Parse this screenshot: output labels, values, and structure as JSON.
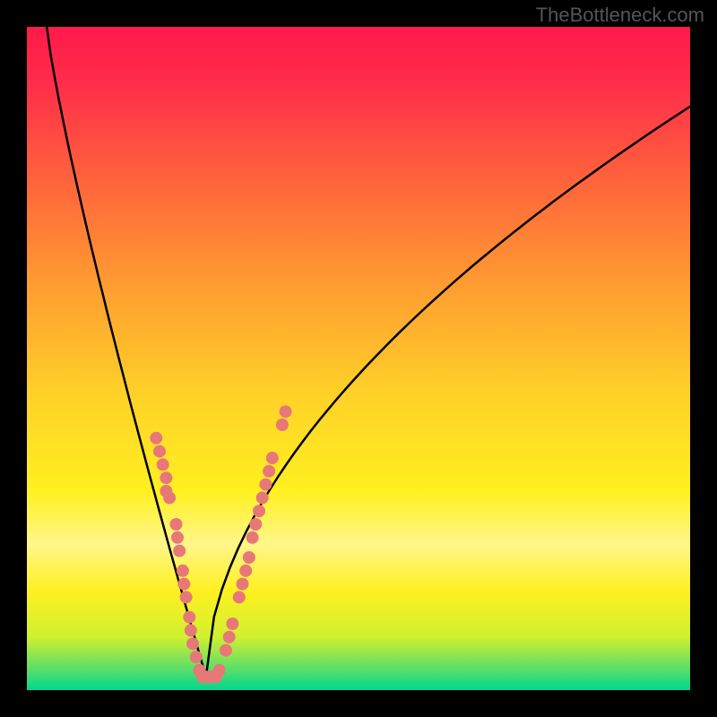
{
  "watermark": "TheBottleneck.com",
  "chart_data": {
    "type": "line",
    "title": "",
    "xlabel": "",
    "ylabel": "",
    "xlim": [
      0,
      100
    ],
    "ylim": [
      0,
      100
    ],
    "background_gradient": {
      "stops": [
        {
          "pos": 0,
          "color": "#ff1a4a"
        },
        {
          "pos": 0.08,
          "color": "#ff2b4a"
        },
        {
          "pos": 0.25,
          "color": "#ff6a3a"
        },
        {
          "pos": 0.4,
          "color": "#ffa030"
        },
        {
          "pos": 0.55,
          "color": "#ffd028"
        },
        {
          "pos": 0.7,
          "color": "#fff020"
        },
        {
          "pos": 0.78,
          "color": "#fff68a"
        },
        {
          "pos": 0.85,
          "color": "#fff020"
        },
        {
          "pos": 0.92,
          "color": "#d0f030"
        },
        {
          "pos": 0.96,
          "color": "#70e060"
        },
        {
          "pos": 1.0,
          "color": "#00d890"
        }
      ]
    },
    "curve": {
      "type": "v_shape",
      "minimum_x": 27,
      "minimum_y": 98,
      "left_branch_start": {
        "x": 3,
        "y": 0
      },
      "right_branch_end": {
        "x": 100,
        "y": 12
      },
      "description": "V-shaped valley curve with steep descent and shallower ascent"
    },
    "scatter_points": {
      "color": "#e87878",
      "radius": 7,
      "points": [
        {
          "x": 19.5,
          "y": 62
        },
        {
          "x": 20.0,
          "y": 64
        },
        {
          "x": 20.5,
          "y": 66
        },
        {
          "x": 21.0,
          "y": 68
        },
        {
          "x": 21.0,
          "y": 70
        },
        {
          "x": 21.5,
          "y": 71
        },
        {
          "x": 22.5,
          "y": 75
        },
        {
          "x": 22.7,
          "y": 77
        },
        {
          "x": 23.0,
          "y": 79
        },
        {
          "x": 23.5,
          "y": 82
        },
        {
          "x": 23.7,
          "y": 84
        },
        {
          "x": 24.0,
          "y": 86
        },
        {
          "x": 24.5,
          "y": 89
        },
        {
          "x": 24.7,
          "y": 91
        },
        {
          "x": 25.0,
          "y": 93
        },
        {
          "x": 25.5,
          "y": 95
        },
        {
          "x": 26.0,
          "y": 97
        },
        {
          "x": 26.5,
          "y": 98
        },
        {
          "x": 27.0,
          "y": 98
        },
        {
          "x": 27.5,
          "y": 98
        },
        {
          "x": 28.0,
          "y": 98
        },
        {
          "x": 28.5,
          "y": 98
        },
        {
          "x": 29.0,
          "y": 97
        },
        {
          "x": 30.0,
          "y": 94
        },
        {
          "x": 30.5,
          "y": 92
        },
        {
          "x": 31.0,
          "y": 90
        },
        {
          "x": 32.0,
          "y": 86
        },
        {
          "x": 32.5,
          "y": 84
        },
        {
          "x": 33.0,
          "y": 82
        },
        {
          "x": 33.5,
          "y": 80
        },
        {
          "x": 34.0,
          "y": 77
        },
        {
          "x": 34.5,
          "y": 75
        },
        {
          "x": 35.0,
          "y": 73
        },
        {
          "x": 35.5,
          "y": 71
        },
        {
          "x": 36.0,
          "y": 69
        },
        {
          "x": 36.5,
          "y": 67
        },
        {
          "x": 37.0,
          "y": 65
        },
        {
          "x": 38.5,
          "y": 60
        },
        {
          "x": 39.0,
          "y": 58
        }
      ]
    }
  }
}
